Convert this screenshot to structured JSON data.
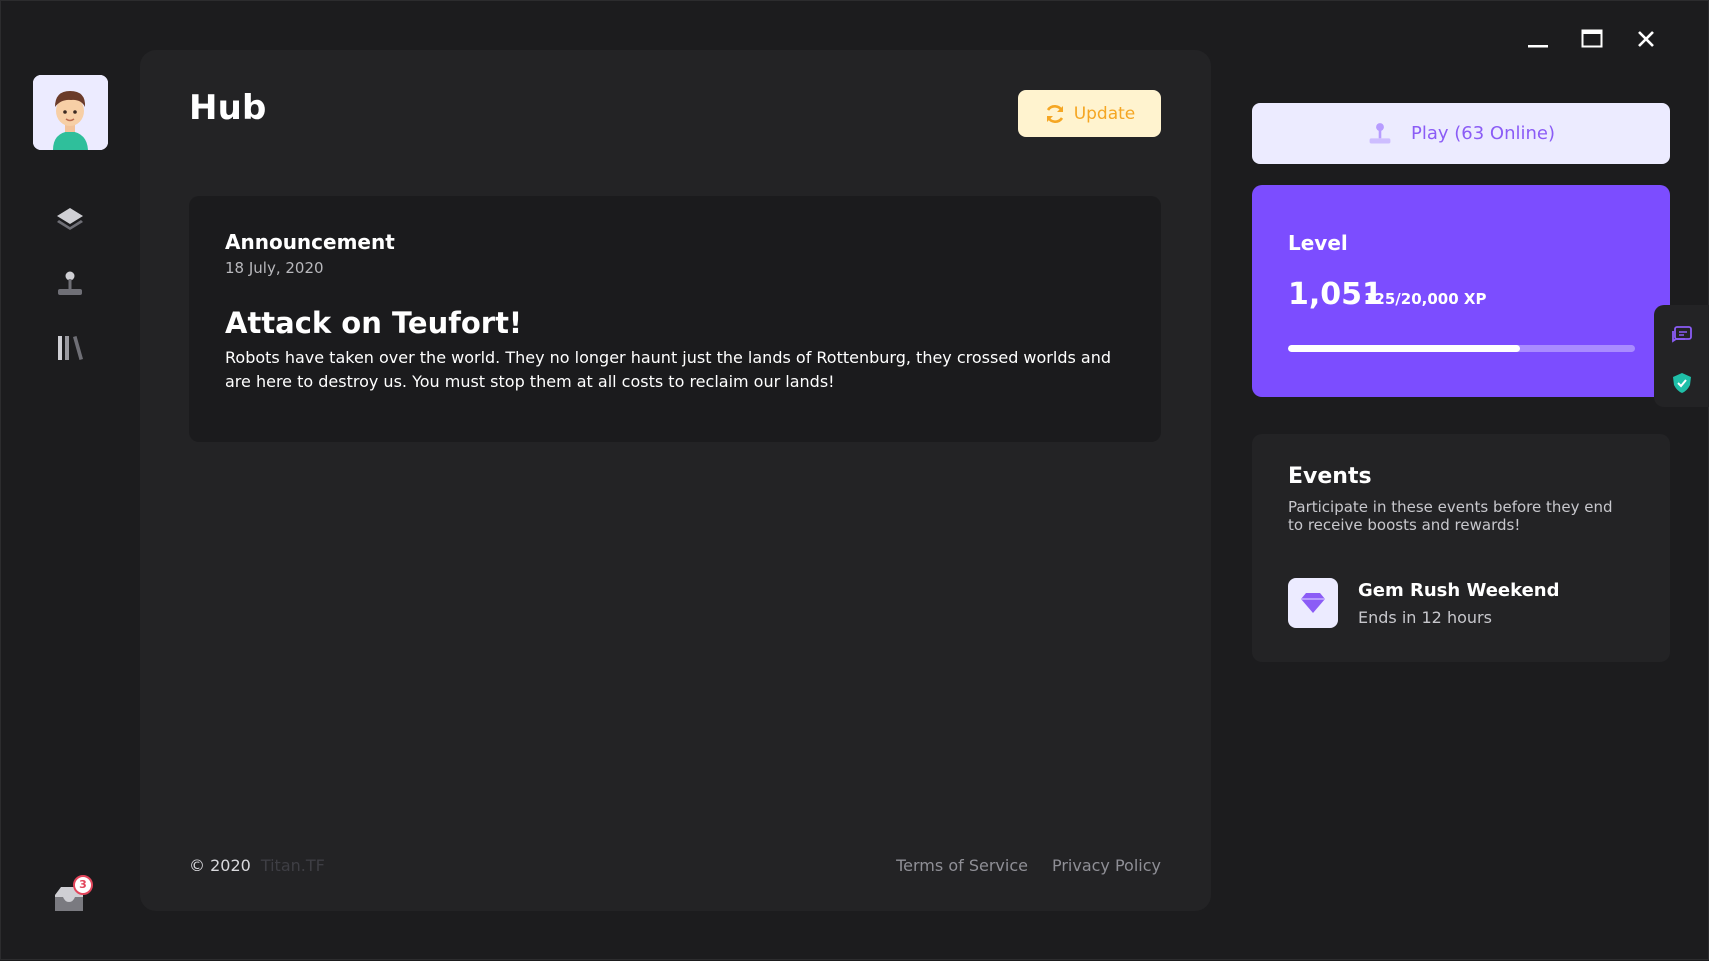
{
  "sidebar": {
    "avatar_icon": "user-avatar",
    "nav": [
      {
        "name": "layers",
        "icon": "layers-icon"
      },
      {
        "name": "play",
        "icon": "joystick-icon"
      },
      {
        "name": "library",
        "icon": "library-icon"
      }
    ],
    "inbox": {
      "icon": "inbox-icon",
      "badge": "3"
    }
  },
  "main": {
    "title": "Hub",
    "update_label": "Update",
    "announcement": {
      "label": "Announcement",
      "date": "18 July, 2020",
      "title": "Attack on Teufort!",
      "body": "Robots have taken over the world. They no longer haunt just the lands of Rottenburg, they crossed worlds and are here to destroy us. You must stop them at all costs to reclaim our lands!"
    },
    "footer": {
      "copyright": "© 2020",
      "brand": "Titan.TF",
      "links": [
        "Terms of Service",
        "Privacy Policy"
      ]
    }
  },
  "window_controls": [
    "minimize-icon",
    "maximize-icon",
    "close-icon"
  ],
  "right": {
    "play_label": "Play (63 Online)",
    "level": {
      "label": "Level",
      "value": "1,051",
      "xp": "125/20,000 XP",
      "progress_fraction": 0.67
    },
    "events": {
      "title": "Events",
      "subtitle": "Participate in these events before they end to receive boosts and rewards!",
      "items": [
        {
          "name": "Gem Rush Weekend",
          "time": "Ends in 12 hours",
          "icon": "gem-icon"
        }
      ]
    }
  },
  "colors": {
    "accent": "#7c4dff",
    "update": "#f5a623",
    "badge": "#e2455b",
    "shield": "#1fbfa8"
  }
}
